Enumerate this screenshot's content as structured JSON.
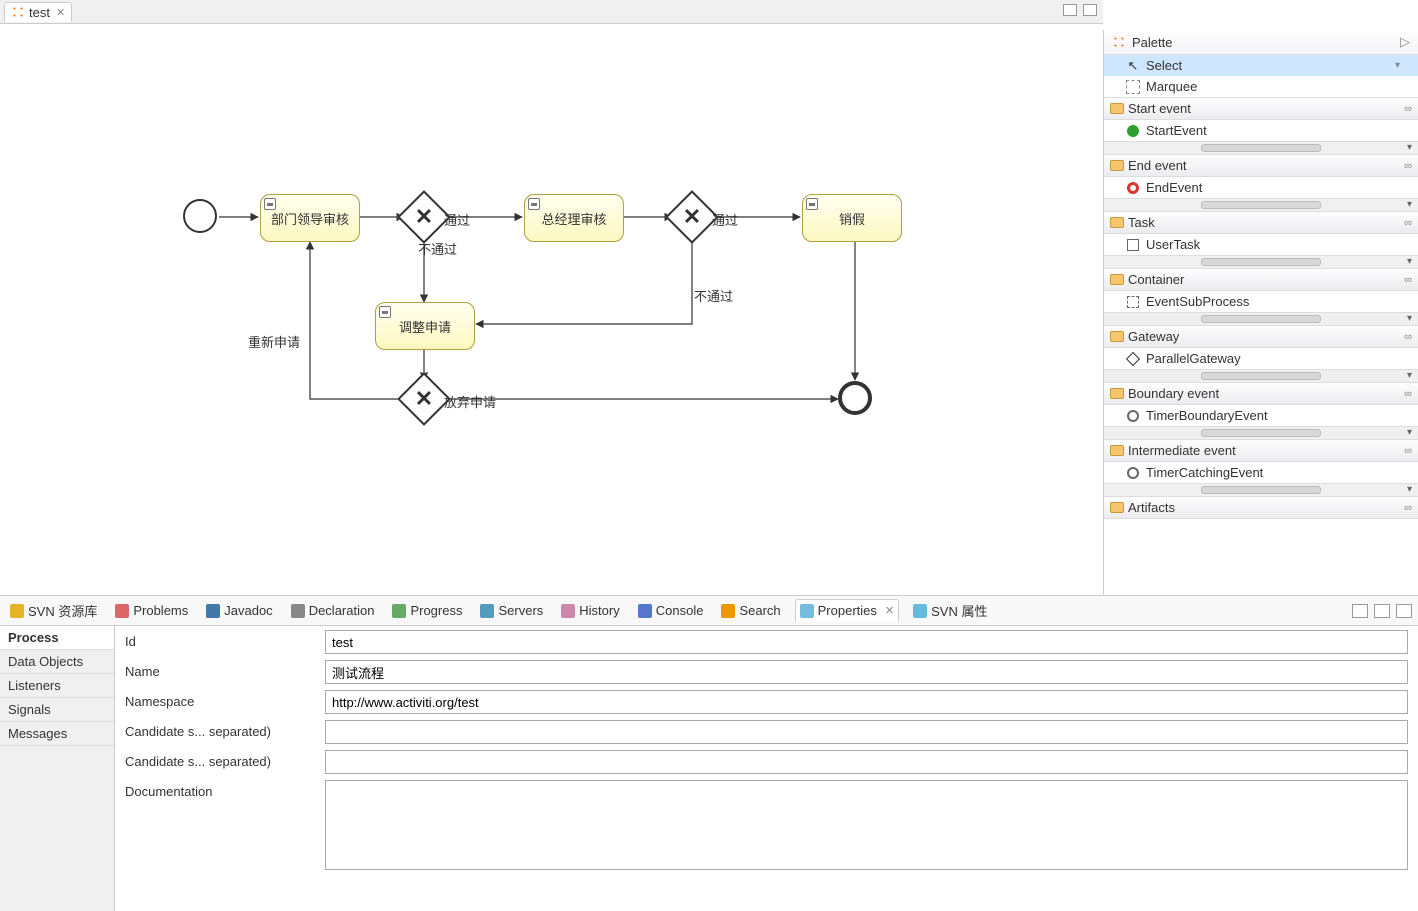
{
  "editor": {
    "tab_title": "test"
  },
  "diagram": {
    "tasks": {
      "dept": "部门领导审核",
      "gm": "总经理审核",
      "cancel": "销假",
      "adjust": "调整申请"
    },
    "labels": {
      "pass1": "通过",
      "fail1": "不通过",
      "pass2": "通过",
      "fail2": "不通过",
      "reapply": "重新申请",
      "abandon": "放弃申请"
    }
  },
  "palette": {
    "title": "Palette",
    "tools": {
      "select": "Select",
      "marquee": "Marquee"
    },
    "sections": [
      {
        "title": "Start event",
        "items": [
          "StartEvent"
        ]
      },
      {
        "title": "End event",
        "items": [
          "EndEvent"
        ]
      },
      {
        "title": "Task",
        "items": [
          "UserTask"
        ]
      },
      {
        "title": "Container",
        "items": [
          "EventSubProcess"
        ]
      },
      {
        "title": "Gateway",
        "items": [
          "ParallelGateway"
        ]
      },
      {
        "title": "Boundary event",
        "items": [
          "TimerBoundaryEvent"
        ]
      },
      {
        "title": "Intermediate event",
        "items": [
          "TimerCatchingEvent"
        ]
      },
      {
        "title": "Artifacts",
        "items": []
      }
    ]
  },
  "views": {
    "tabs": [
      "SVN 资源库",
      "Problems",
      "Javadoc",
      "Declaration",
      "Progress",
      "Servers",
      "History",
      "Console",
      "Search",
      "Properties",
      "SVN 属性"
    ],
    "active": "Properties"
  },
  "properties": {
    "sidebar": [
      "Process",
      "Data Objects",
      "Listeners",
      "Signals",
      "Messages"
    ],
    "active": "Process",
    "fields": {
      "id_label": "Id",
      "id_value": "test",
      "name_label": "Name",
      "name_value": "测试流程",
      "ns_label": "Namespace",
      "ns_value": "http://www.activiti.org/test",
      "cs_label": "Candidate s... separated)",
      "cs_value": "",
      "cu_label": "Candidate s... separated)",
      "cu_value": "",
      "doc_label": "Documentation",
      "doc_value": ""
    }
  }
}
